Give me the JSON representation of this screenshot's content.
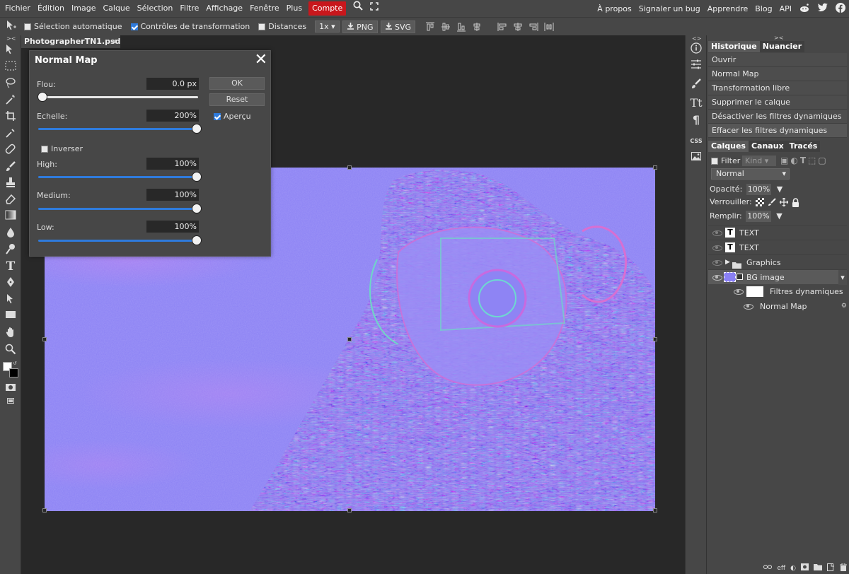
{
  "menu": {
    "items": [
      "Fichier",
      "Édition",
      "Image",
      "Calque",
      "Sélection",
      "Filtre",
      "Affichage",
      "Fenêtre",
      "Plus"
    ],
    "account_label": "Compte",
    "right_links": [
      "À propos",
      "Signaler un bug",
      "Apprendre",
      "Blog",
      "API"
    ]
  },
  "options": {
    "auto_select_label": "Sélection automatique",
    "transform_controls_label": "Contrôles de transformation",
    "distances_label": "Distances",
    "zoom_select": "1x",
    "png_label": "PNG",
    "svg_label": "SVG"
  },
  "document": {
    "tab_label": "PhotographerTN1.psd *",
    "tab_close": "×"
  },
  "dialog": {
    "title": "Normal Map",
    "close": "✕",
    "blur_label": "Flou:",
    "blur_value": "0.0 px",
    "blur_level": 0,
    "scale_label": "Echelle:",
    "scale_value": "200%",
    "scale_level": 1,
    "invert_label": "Inverser",
    "invert_checked": false,
    "high_label": "High:",
    "high_value": "100%",
    "high_level": 1,
    "medium_label": "Medium:",
    "medium_value": "100%",
    "medium_level": 1,
    "low_label": "Low:",
    "low_value": "100%",
    "low_level": 1,
    "ok_label": "OK",
    "reset_label": "Reset",
    "preview_label": "Aperçu",
    "preview_checked": true
  },
  "history": {
    "tabs": [
      "Historique",
      "Nuancier"
    ],
    "items": [
      "Ouvrir",
      "Normal Map",
      "Transformation libre",
      "Supprimer le calque",
      "Désactiver les filtres dynamiques",
      "Effacer les filtres dynamiques"
    ]
  },
  "layers": {
    "tabs": [
      "Calques",
      "Canaux",
      "Tracés"
    ],
    "filter_label": "Filter",
    "kind_placeholder": "Kind",
    "blend_mode": "Normal",
    "opacity_label": "Opacité:",
    "opacity_value": "100%",
    "lock_label": "Verrouiller:",
    "fill_label": "Remplir:",
    "fill_value": "100%",
    "items": [
      {
        "name": "TEXT",
        "thumb": "T"
      },
      {
        "name": "TEXT",
        "thumb": "T"
      },
      {
        "name": "Graphics",
        "thumb": "folder"
      },
      {
        "name": "BG image",
        "thumb": "image"
      },
      {
        "name": "Filtres dynamiques",
        "thumb": "white"
      },
      {
        "name": "Normal Map",
        "thumb": ""
      }
    ],
    "footer_eff": "eff"
  },
  "colors": {
    "accent_red": "#c8171c",
    "slider_blue": "#2f7bdc",
    "panel_bg": "#474747",
    "workspace_bg": "#282828",
    "normal_map_base": "#8a80f4"
  }
}
